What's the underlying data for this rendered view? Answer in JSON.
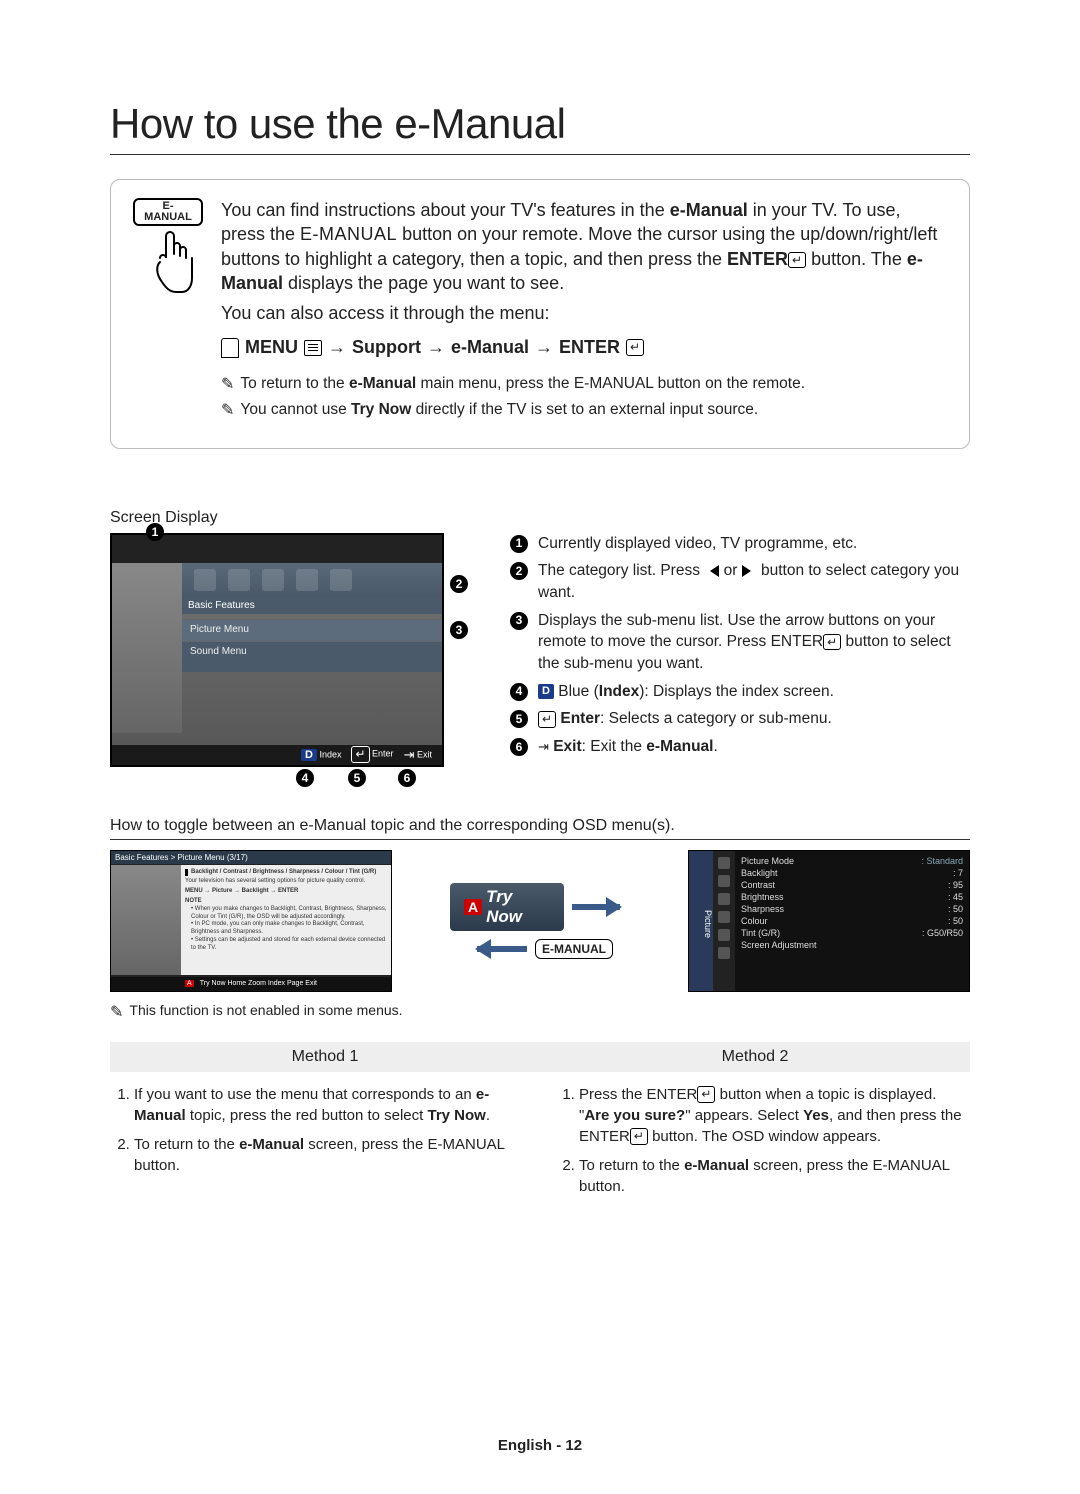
{
  "title": "How to use the e-Manual",
  "remote_button_label": "E-MANUAL",
  "intro": {
    "p1a": "You can find instructions about your TV's features in the ",
    "p1b": "e-Manual",
    "p1c": " in your TV. To use, press the ",
    "p1d": "E-MANUAL",
    "p1e": " button on your remote. Move the cursor using the up/down/right/left buttons to highlight a category, then a topic, and then press the ",
    "p1f": "ENTER",
    "p1g": " button. The ",
    "p1h": "e-Manual",
    "p1i": " displays the page you want to see.",
    "p2": "You can also access it through the menu:"
  },
  "menu_path": {
    "menu": "MENU",
    "support": "Support",
    "emanual": "e-Manual",
    "enter": "ENTER"
  },
  "notes": {
    "n1a": "To return to the ",
    "n1b": "e-Manual",
    "n1c": " main menu, press the ",
    "n1d": "E-MANUAL",
    "n1e": " button on the remote.",
    "n2a": "You cannot use ",
    "n2b": "Try Now",
    "n2c": " directly if the TV is set to an external input source."
  },
  "screen_label": "Screen Display",
  "tv": {
    "cat_label": "Basic Features",
    "row1": "Picture Menu",
    "row2": "Sound Menu",
    "footer_index": "Index",
    "footer_enter": "Enter",
    "footer_exit": "Exit"
  },
  "legend": {
    "l1": "Currently displayed video, TV programme, etc.",
    "l2a": "The category list. Press ",
    "l2b": " or ",
    "l2c": " button to select category you want.",
    "l3a": "Displays the sub-menu list. Use the arrow buttons on your remote to move the cursor. Press ",
    "l3b": "ENTER",
    "l3c": " button to select the sub-menu you want.",
    "l4a": " Blue (",
    "l4b": "Index",
    "l4c": "): Displays the index screen.",
    "l5a": "Enter",
    "l5b": ": Selects a category or sub-menu.",
    "l6a": "Exit",
    "l6b": ": Exit the ",
    "l6c": "e-Manual",
    "l6d": "."
  },
  "toggle_heading": "How to toggle between an e-Manual topic and the corresponding OSD menu(s).",
  "mini": {
    "header": "Basic Features > Picture Menu (3/17)",
    "body_title": "Backlight / Contrast / Brightness / Sharpness / Colour / Tint (G/R)",
    "body_sub": "Your television has several setting options for picture quality control.",
    "body_path": "MENU → Picture → Backlight → ENTER",
    "note_label": "NOTE",
    "bullet1": "When you make changes to Backlight, Contrast, Brightness, Sharpness, Colour or Tint (G/R), the OSD will be adjusted accordingly.",
    "bullet2": "In PC mode, you can only make changes to Backlight, Contrast, Brightness and Sharpness.",
    "bullet3": "Settings can be adjusted and stored for each external device connected to the TV.",
    "footer": "Try Now   Home   Zoom   Index   Page   Exit"
  },
  "try_now": "Try Now",
  "emanual_badge": "E-MANUAL",
  "osd": {
    "side": "Picture",
    "rows": [
      {
        "k": "Picture Mode",
        "v": ": Standard"
      },
      {
        "k": "Backlight",
        "v": ": 7"
      },
      {
        "k": "Contrast",
        "v": ": 95"
      },
      {
        "k": "Brightness",
        "v": ": 45"
      },
      {
        "k": "Sharpness",
        "v": ": 50"
      },
      {
        "k": "Colour",
        "v": ": 50"
      },
      {
        "k": "Tint (G/R)",
        "v": ": G50/R50"
      },
      {
        "k": "Screen Adjustment",
        "v": ""
      }
    ]
  },
  "small_note": "This function is not enabled in some menus.",
  "methods": {
    "h1": "Method 1",
    "h2": "Method 2",
    "m1_1a": "If you want to use the menu that corresponds to an ",
    "m1_1b": "e-Manual",
    "m1_1c": " topic, press the red button to select ",
    "m1_1d": "Try Now",
    "m1_1e": ".",
    "m1_2a": "To return to the ",
    "m1_2b": "e-Manual",
    "m1_2c": " screen, press the ",
    "m1_2d": "E-MANUAL",
    "m1_2e": " button.",
    "m2_1a": "Press the ",
    "m2_1b": "ENTER",
    "m2_1c": " button when a topic is displayed. \"",
    "m2_1d": "Are you sure?",
    "m2_1e": "\" appears. Select ",
    "m2_1f": "Yes",
    "m2_1g": ", and then press the ",
    "m2_1h": "ENTER",
    "m2_1i": " button. The OSD window appears.",
    "m2_2a": "To return to the ",
    "m2_2b": "e-Manual",
    "m2_2c": " screen, press the ",
    "m2_2d": "E-MANUAL",
    "m2_2e": " button."
  },
  "footer": "English - 12"
}
